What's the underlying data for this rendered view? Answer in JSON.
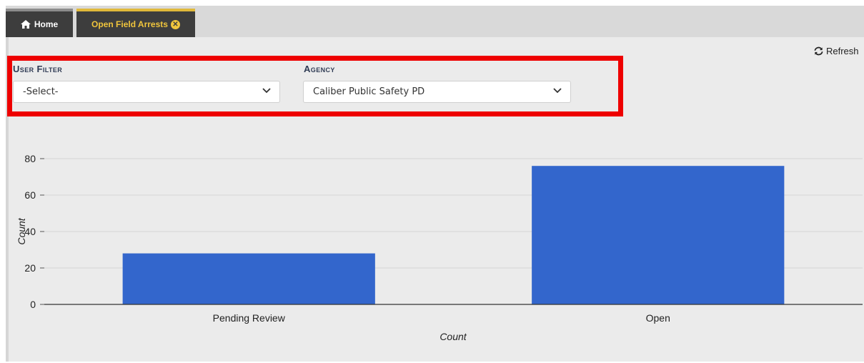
{
  "tabs": {
    "home_label": "Home",
    "active_label": "Open Field Arrests"
  },
  "toolbar": {
    "refresh_label": "Refresh"
  },
  "filters": {
    "user_filter_label": "User Filter",
    "user_filter_value": "-Select-",
    "agency_label": "Agency",
    "agency_value": "Caliber Public Safety PD"
  },
  "colors": {
    "highlight": "#ee0000",
    "bar": "#3366cc",
    "active_tab_text": "#f0c53c"
  },
  "chart_data": {
    "type": "bar",
    "categories": [
      "Pending Review",
      "Open"
    ],
    "values": [
      28,
      76
    ],
    "xlabel": "Count",
    "ylabel": "Count",
    "ylim": [
      0,
      80
    ],
    "yticks": [
      0,
      20,
      40,
      60,
      80
    ],
    "grid": true,
    "legend": "none"
  }
}
